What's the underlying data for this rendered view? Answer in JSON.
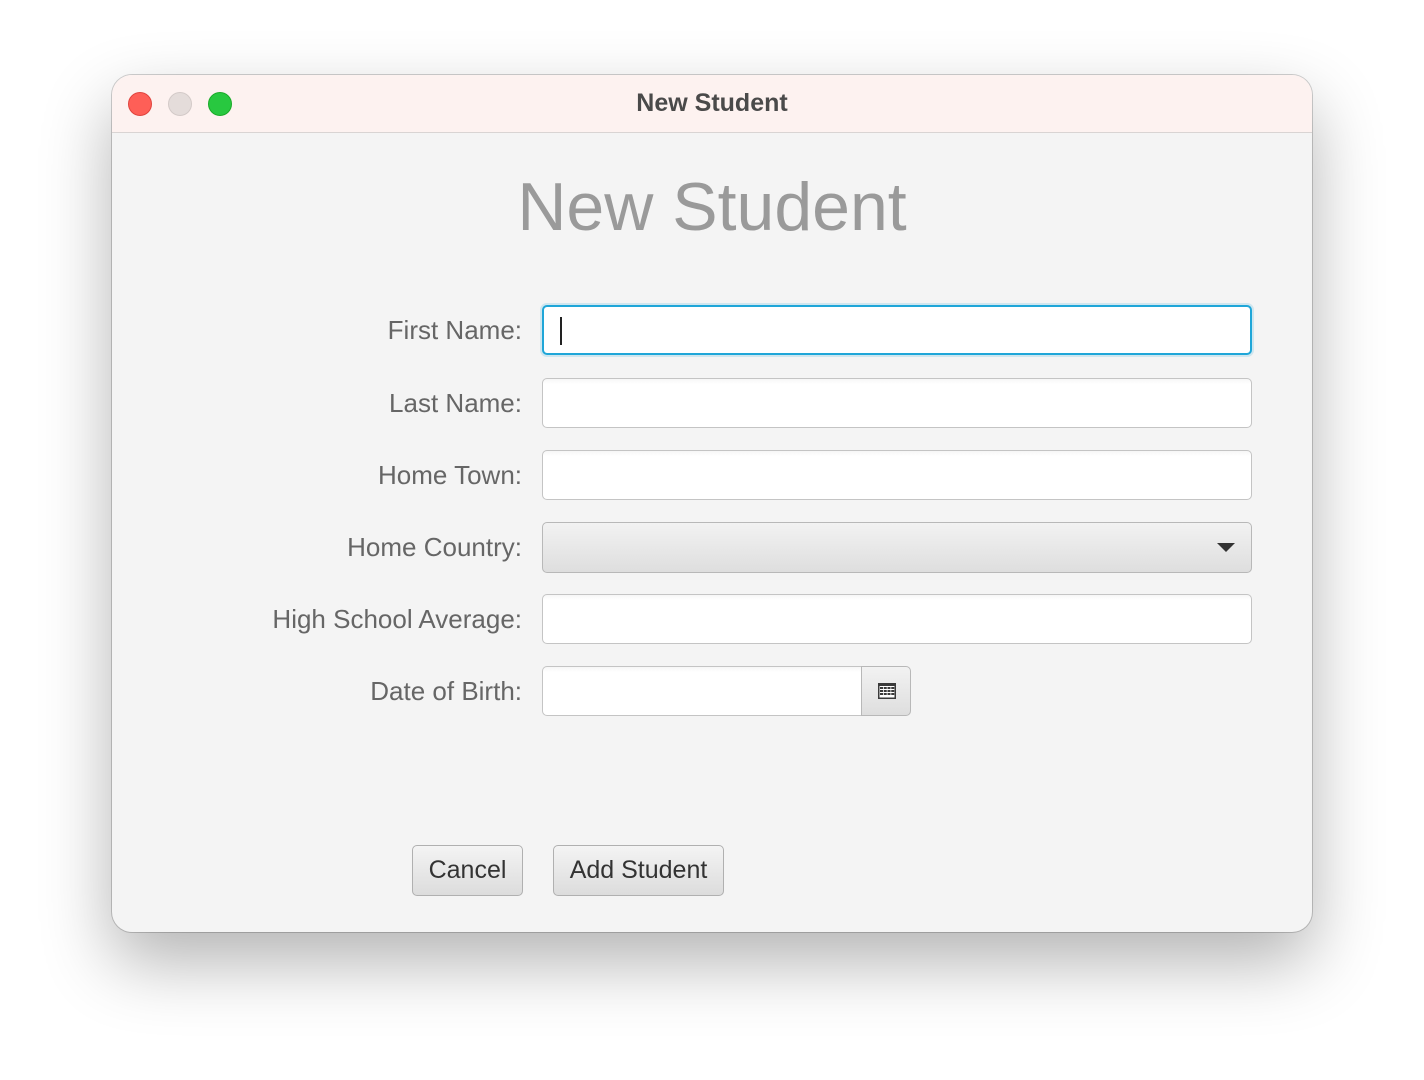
{
  "window": {
    "title": "New Student"
  },
  "form": {
    "heading": "New Student",
    "fields": {
      "first_name": {
        "label": "First Name:",
        "value": "",
        "focused": true
      },
      "last_name": {
        "label": "Last Name:",
        "value": ""
      },
      "home_town": {
        "label": "Home Town:",
        "value": ""
      },
      "home_country": {
        "label": "Home Country:",
        "selected": ""
      },
      "high_school_average": {
        "label": "High School Average:",
        "value": ""
      },
      "date_of_birth": {
        "label": "Date of Birth:",
        "value": ""
      }
    },
    "buttons": {
      "cancel": "Cancel",
      "add_student": "Add Student"
    }
  },
  "icons": {
    "close": "close-traffic-light",
    "minimize": "minimize-traffic-light",
    "zoom": "zoom-traffic-light",
    "dropdown": "chevron-down-icon",
    "calendar": "calendar-icon"
  },
  "colors": {
    "focus_ring": "#1fa6d8",
    "close": "#fe5f57",
    "zoom": "#28c840"
  }
}
